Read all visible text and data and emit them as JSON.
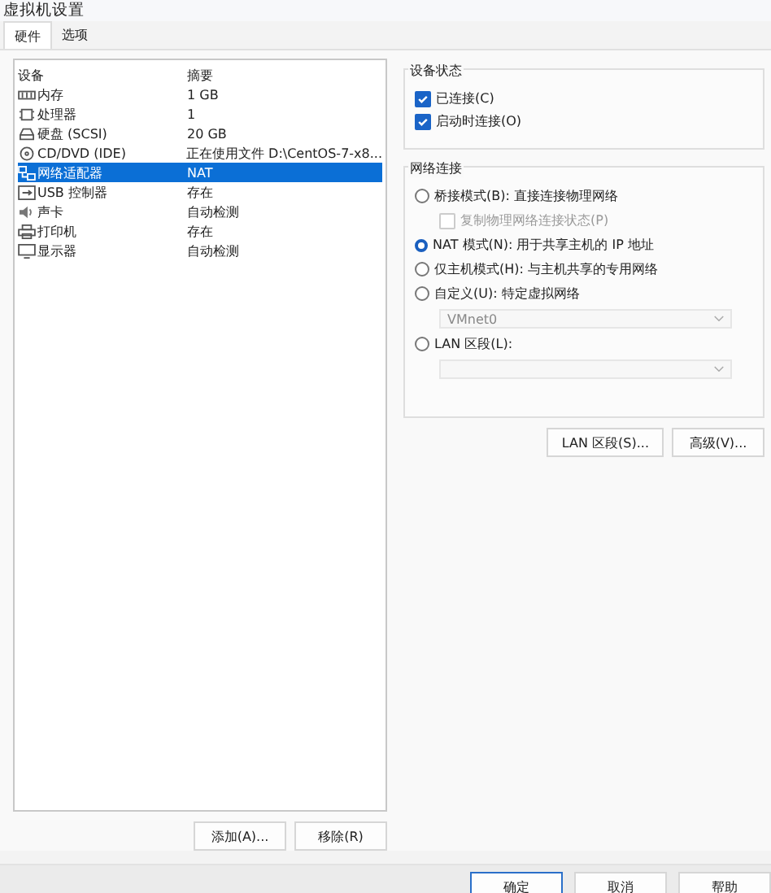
{
  "window": {
    "title": "虚拟机设置"
  },
  "tabs": [
    {
      "label": "硬件",
      "selected": true
    },
    {
      "label": "选项",
      "selected": false
    }
  ],
  "devices": {
    "columns": [
      "设备",
      "摘要"
    ],
    "rows": [
      {
        "kind": "memory",
        "name": "内存",
        "summary": "1 GB",
        "selected": false
      },
      {
        "kind": "cpu",
        "name": "处理器",
        "summary": "1",
        "selected": false
      },
      {
        "kind": "disk",
        "name": "硬盘 (SCSI)",
        "summary": "20 GB",
        "selected": false
      },
      {
        "kind": "cd",
        "name": "CD/DVD (IDE)",
        "summary": "正在使用文件 D:\\CentOS-7-x8...",
        "selected": false
      },
      {
        "kind": "network",
        "name": "网络适配器",
        "summary": "NAT",
        "selected": true
      },
      {
        "kind": "usb",
        "name": "USB 控制器",
        "summary": "存在",
        "selected": false
      },
      {
        "kind": "sound",
        "name": "声卡",
        "summary": "自动检测",
        "selected": false
      },
      {
        "kind": "printer",
        "name": "打印机",
        "summary": "存在",
        "selected": false
      },
      {
        "kind": "display",
        "name": "显示器",
        "summary": "自动检测",
        "selected": false
      }
    ],
    "buttons": [
      "添加(A)...",
      "移除(R)"
    ]
  },
  "device_status": {
    "title": "设备状态",
    "options": [
      {
        "label": "已连接(C)",
        "checked": true
      },
      {
        "label": "启动时连接(O)",
        "checked": true
      }
    ]
  },
  "network_connection": {
    "title": "网络连接",
    "options": [
      {
        "kind": "radio",
        "label": "桥接模式(B): 直接连接物理网络",
        "selected": false
      },
      {
        "kind": "checkbox",
        "label": "复制物理网络连接状态(P)",
        "checked": false,
        "disabled": true
      },
      {
        "kind": "radio",
        "label": "NAT 模式(N): 用于共享主机的 IP 地址",
        "selected": true
      },
      {
        "kind": "radio",
        "label": "仅主机模式(H): 与主机共享的专用网络",
        "selected": false
      },
      {
        "kind": "radio",
        "label": "自定义(U): 特定虚拟网络",
        "selected": false
      },
      {
        "kind": "select",
        "value": "VMnet0",
        "disabled": true
      },
      {
        "kind": "radio",
        "label": "LAN 区段(L):",
        "selected": false
      },
      {
        "kind": "select",
        "disabled": true
      }
    ]
  },
  "buttons": [
    "LAN 区段(S)...",
    "高级(V)..."
  ],
  "footer_buttons": [
    "确定",
    "取消",
    "帮助"
  ]
}
